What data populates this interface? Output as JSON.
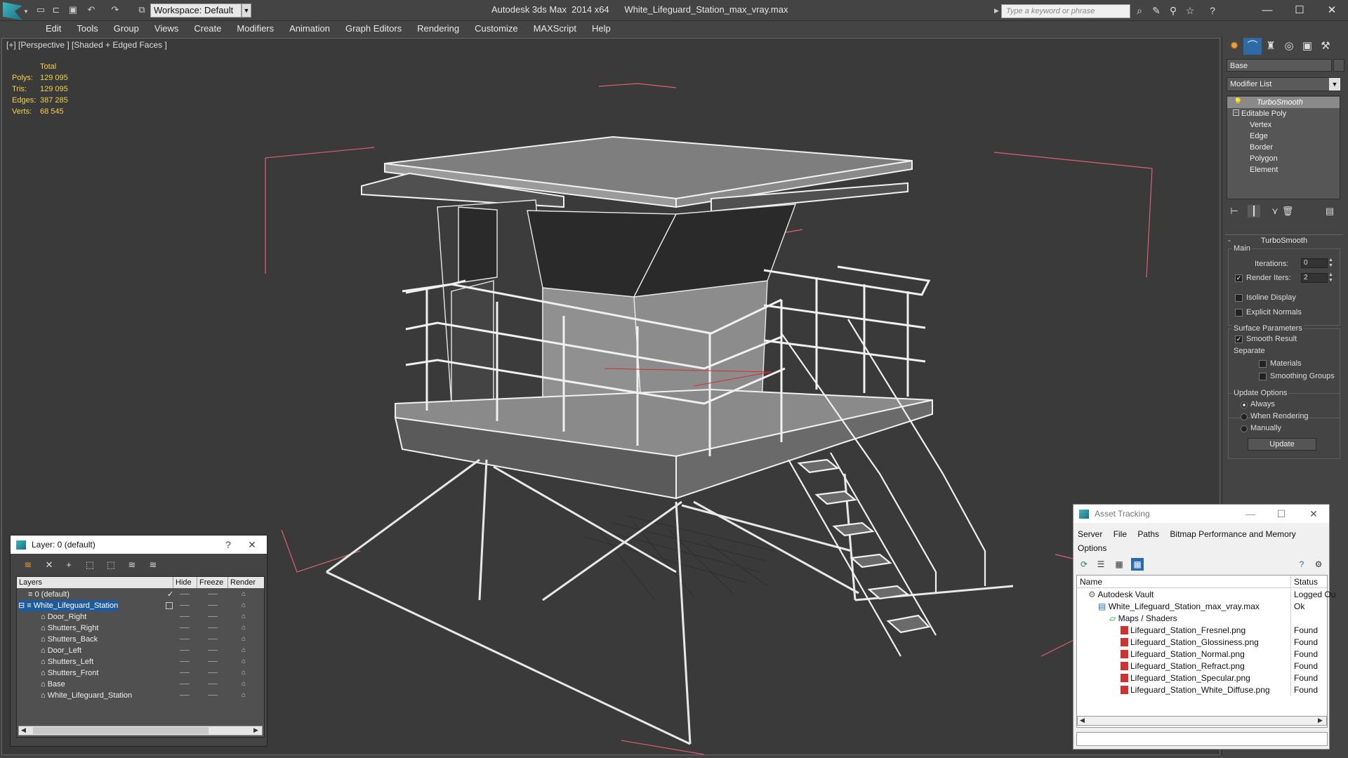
{
  "app": {
    "title": "Autodesk 3ds Max  2014 x64      White_Lifeguard_Station_max_vray.max",
    "workspace_label": "Workspace: Default",
    "search_placeholder": "Type a keyword or phrase"
  },
  "menu": [
    "Edit",
    "Tools",
    "Group",
    "Views",
    "Create",
    "Modifiers",
    "Animation",
    "Graph Editors",
    "Rendering",
    "Customize",
    "MAXScript",
    "Help"
  ],
  "viewport": {
    "label": "[+] [Perspective ] [Shaded + Edged Faces ]",
    "stats_header": "Total",
    "stats": [
      {
        "key": "Polys:",
        "value": "129 095"
      },
      {
        "key": "Tris:",
        "value": "129 095"
      },
      {
        "key": "Edges:",
        "value": "387 285"
      },
      {
        "key": "Verts:",
        "value": "68 545"
      }
    ]
  },
  "command_panel": {
    "object_name": "Base",
    "modifier_list": "Modifier List",
    "stack": [
      "TurboSmooth",
      "Editable Poly",
      "Vertex",
      "Edge",
      "Border",
      "Polygon",
      "Element"
    ],
    "rollout_title": "TurboSmooth",
    "main_label": "Main",
    "iterations_label": "Iterations:",
    "iterations_value": "0",
    "render_iters_label": "Render Iters:",
    "render_iters_value": "2",
    "isoline_label": "Isoline Display",
    "explicit_normals_label": "Explicit Normals",
    "surface_params_label": "Surface Parameters",
    "smooth_result_label": "Smooth Result",
    "separate_label": "Separate",
    "materials_label": "Materials",
    "smoothing_groups_label": "Smoothing Groups",
    "update_options_label": "Update Options",
    "always_label": "Always",
    "when_rendering_label": "When Rendering",
    "manually_label": "Manually",
    "update_button": "Update"
  },
  "layer_dialog": {
    "title": "Layer: 0 (default)",
    "help": "?",
    "close": "✕",
    "columns": [
      "Layers",
      "Hide",
      "Freeze",
      "Render"
    ],
    "rows": [
      "0 (default)",
      "White_Lifeguard_Station",
      "Door_Right",
      "Shutters_Right",
      "Shutters_Back",
      "Door_Left",
      "Shutters_Left",
      "Shutters_Front",
      "Base",
      "White_Lifeguard_Station"
    ]
  },
  "asset_dialog": {
    "title": "Asset Tracking",
    "menu": [
      "Server",
      "File",
      "Paths",
      "Bitmap Performance and Memory"
    ],
    "menu_line2": "Options",
    "columns": [
      "Name",
      "Status"
    ],
    "rows": [
      {
        "name": "Autodesk Vault",
        "status": "Logged Ou"
      },
      {
        "name": "White_Lifeguard_Station_max_vray.max",
        "status": "Ok"
      },
      {
        "name": "Maps / Shaders",
        "status": ""
      },
      {
        "name": "Lifeguard_Station_Fresnel.png",
        "status": "Found"
      },
      {
        "name": "Lifeguard_Station_Glossiness.png",
        "status": "Found"
      },
      {
        "name": "Lifeguard_Station_Normal.png",
        "status": "Found"
      },
      {
        "name": "Lifeguard_Station_Refract.png",
        "status": "Found"
      },
      {
        "name": "Lifeguard_Station_Specular.png",
        "status": "Found"
      },
      {
        "name": "Lifeguard_Station_White_Diffuse.png",
        "status": "Found"
      }
    ]
  },
  "colors": {
    "stats_text": "#f2d24a",
    "selection": "#1e5a9e",
    "wire": "#f0f0f0",
    "bounding_box": "#d9607a"
  }
}
